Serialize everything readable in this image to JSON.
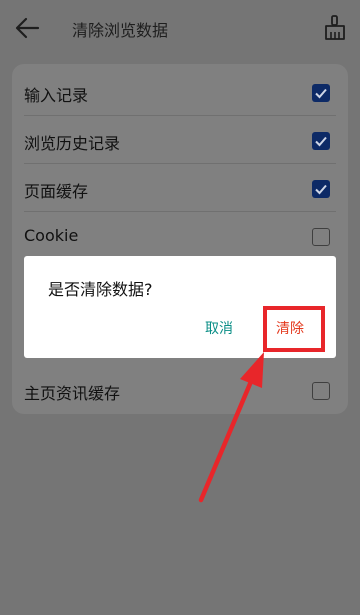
{
  "header": {
    "title": "清除浏览数据",
    "back_icon": "arrow-left-icon",
    "clear_icon": "broom-icon"
  },
  "settings": {
    "items": [
      {
        "label": "输入记录",
        "checked": true
      },
      {
        "label": "浏览历史记录",
        "checked": true
      },
      {
        "label": "页面缓存",
        "checked": true
      },
      {
        "label": "Cookie",
        "checked": false
      },
      {
        "label": "主页资讯缓存",
        "checked": false
      }
    ]
  },
  "dialog": {
    "title": "是否清除数据?",
    "cancel_label": "取消",
    "confirm_label": "清除"
  },
  "colors": {
    "checkbox_checked": "#0d2a66",
    "cancel_text": "#0a8e86",
    "confirm_text": "#e4391e",
    "annotation_red": "#e8262a"
  }
}
